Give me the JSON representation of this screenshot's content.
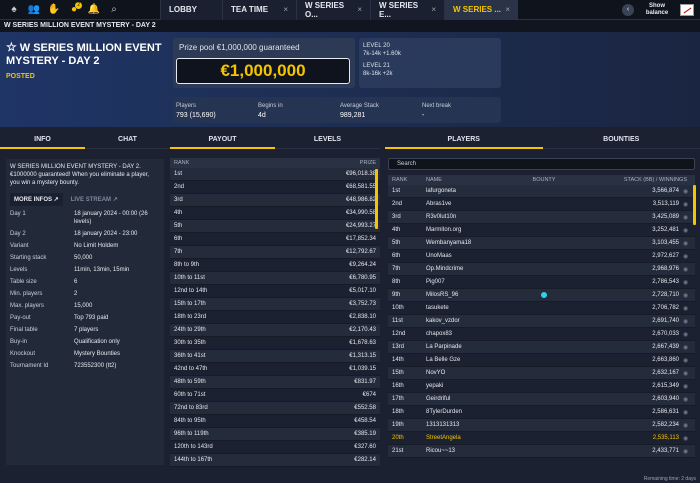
{
  "topbar": {
    "notif_count": "2",
    "tabs": [
      {
        "label": "LOBBY",
        "active": false,
        "closable": false
      },
      {
        "label": "TEA TIME",
        "active": false,
        "closable": true
      },
      {
        "label": "W SERIES O...",
        "active": false,
        "closable": true
      },
      {
        "label": "W SERIES E...",
        "active": false,
        "closable": true
      },
      {
        "label": "W SERIES ...",
        "active": true,
        "closable": true
      }
    ],
    "show_balance": "Show balance",
    "close_glyph": "×"
  },
  "title_bar": "W SERIES MILLION EVENT MYSTERY - DAY 2",
  "header": {
    "title": "W SERIES MILLION EVENT MYSTERY - DAY 2",
    "status": "POSTED",
    "prize_label": "Prize pool  €1,000,000 guaranteed",
    "prize_amount": "€1,000,000",
    "level_current": "LEVEL 20",
    "level_current_blinds": "7k-14k +1.60k",
    "level_next": "LEVEL 21",
    "level_next_blinds": "8k-16k +2k",
    "stats": [
      {
        "label": "Players",
        "value": "793 (15,690)"
      },
      {
        "label": "Begins in",
        "value": "4d"
      },
      {
        "label": "Average Stack",
        "value": "989,281"
      },
      {
        "label": "Next break",
        "value": "-"
      }
    ]
  },
  "left": {
    "tabs": [
      "INFO",
      "CHAT"
    ],
    "description": "W SERIES MILLION EVENT MYSTERY - DAY 2. €1000000 guaranteed! When you eliminate a player, you win a mystery bounty.",
    "more_info": "MORE INFOS ↗",
    "live_stream": "LIVE STREAM ↗",
    "details": [
      {
        "k": "Day 1",
        "v": "18 january 2024 - 00:00 (26 levels)"
      },
      {
        "k": "Day 2",
        "v": "18 january 2024 - 23:00"
      },
      {
        "k": "Variant",
        "v": "No Limit Holdem"
      },
      {
        "k": "Starting stack",
        "v": "50,000"
      },
      {
        "k": "Levels",
        "v": "11min, 13min, 15min"
      },
      {
        "k": "Table size",
        "v": "6"
      },
      {
        "k": "Min. players",
        "v": "2"
      },
      {
        "k": "Max. players",
        "v": "15,000"
      },
      {
        "k": "Pay-out",
        "v": "Top 793 paid"
      },
      {
        "k": "Final table",
        "v": "7 players"
      },
      {
        "k": "Buy-in",
        "v": "Qualification only"
      },
      {
        "k": "Knockout",
        "v": "Mystery Bounties"
      },
      {
        "k": "Tournament Id",
        "v": "723552300 (tt2)"
      }
    ]
  },
  "payout": {
    "tabs": [
      "PAYOUT",
      "LEVELS"
    ],
    "head": {
      "rank": "RANK",
      "prize": "PRIZE"
    },
    "rows": [
      [
        "1st",
        "€96,018.38"
      ],
      [
        "2nd",
        "€68,581.55"
      ],
      [
        "3rd",
        "€48,986.82"
      ],
      [
        "4th",
        "€34,990.58"
      ],
      [
        "5th",
        "€24,993.27"
      ],
      [
        "6th",
        "€17,852.34"
      ],
      [
        "7th",
        "€12,792.67"
      ],
      [
        "8th to 9th",
        "€9,264.24"
      ],
      [
        "10th to 11st",
        "€6,780.95"
      ],
      [
        "12nd to 14th",
        "€5,017.10"
      ],
      [
        "15th to 17th",
        "€3,752.73"
      ],
      [
        "18th to 23rd",
        "€2,838.10"
      ],
      [
        "24th to 29th",
        "€2,170.43"
      ],
      [
        "30th to 35th",
        "€1,678.63"
      ],
      [
        "36th to 41st",
        "€1,313.15"
      ],
      [
        "42nd to 47th",
        "€1,039.15"
      ],
      [
        "48th to 59th",
        "€831.97"
      ],
      [
        "60th to 71st",
        "€674"
      ],
      [
        "72nd to 83rd",
        "€552.58"
      ],
      [
        "84th to 95th",
        "€458.54"
      ],
      [
        "96th to 119th",
        "€385.19"
      ],
      [
        "120th to 143rd",
        "€327.60"
      ],
      [
        "144th to 167th",
        "€282.14"
      ]
    ]
  },
  "players": {
    "tabs": [
      "PLAYERS",
      "BOUNTIES"
    ],
    "search_placeholder": "Search",
    "head": {
      "rank": "RANK",
      "name": "NAME",
      "bounty": "BOUNTY",
      "stack": "STACK (BB) / WINNINGS"
    },
    "rows": [
      [
        "1st",
        "lafurgoneta",
        "3,566,874"
      ],
      [
        "2nd",
        "Abras1ve",
        "3,513,119"
      ],
      [
        "3rd",
        "R3v0lut10n",
        "3,425,089"
      ],
      [
        "4th",
        "Marmiton.org",
        "3,252,481"
      ],
      [
        "5th",
        "Wembanyama18",
        "3,103,455"
      ],
      [
        "6th",
        "UnoMaas",
        "2,972,627"
      ],
      [
        "7th",
        "Op.Mindcrime",
        "2,968,976"
      ],
      [
        "8th",
        "Pig007",
        "2,786,543"
      ],
      [
        "9th",
        "MilosRS_96",
        "2,728,710"
      ],
      [
        "10th",
        "tasukete",
        "2,706,782"
      ],
      [
        "11st",
        "kakov_vzdor",
        "2,691,740"
      ],
      [
        "12nd",
        "chapox83",
        "2,670,033"
      ],
      [
        "13rd",
        "La Parpinade",
        "2,667,439"
      ],
      [
        "14th",
        "La Belle Gze",
        "2,663,860"
      ],
      [
        "15th",
        "NovYO",
        "2,632,167"
      ],
      [
        "16th",
        "yepaki",
        "2,615,349"
      ],
      [
        "17th",
        "Geirdriful",
        "2,603,940"
      ],
      [
        "18th",
        "8TylerDurden",
        "2,586,631"
      ],
      [
        "19th",
        "1313131313",
        "2,582,234"
      ],
      [
        "20th",
        "StreetAngela",
        "2,535,113"
      ],
      [
        "21st",
        "Ricou~~13",
        "2,433,771"
      ]
    ],
    "bounty_row_index": 8,
    "highlight_row_index": 19,
    "stack_icon": "info-icon"
  },
  "footer": "Remaining time: 2 days",
  "colors": {
    "accent": "#f5c400",
    "bounty_dot": "#2fd0ea"
  }
}
